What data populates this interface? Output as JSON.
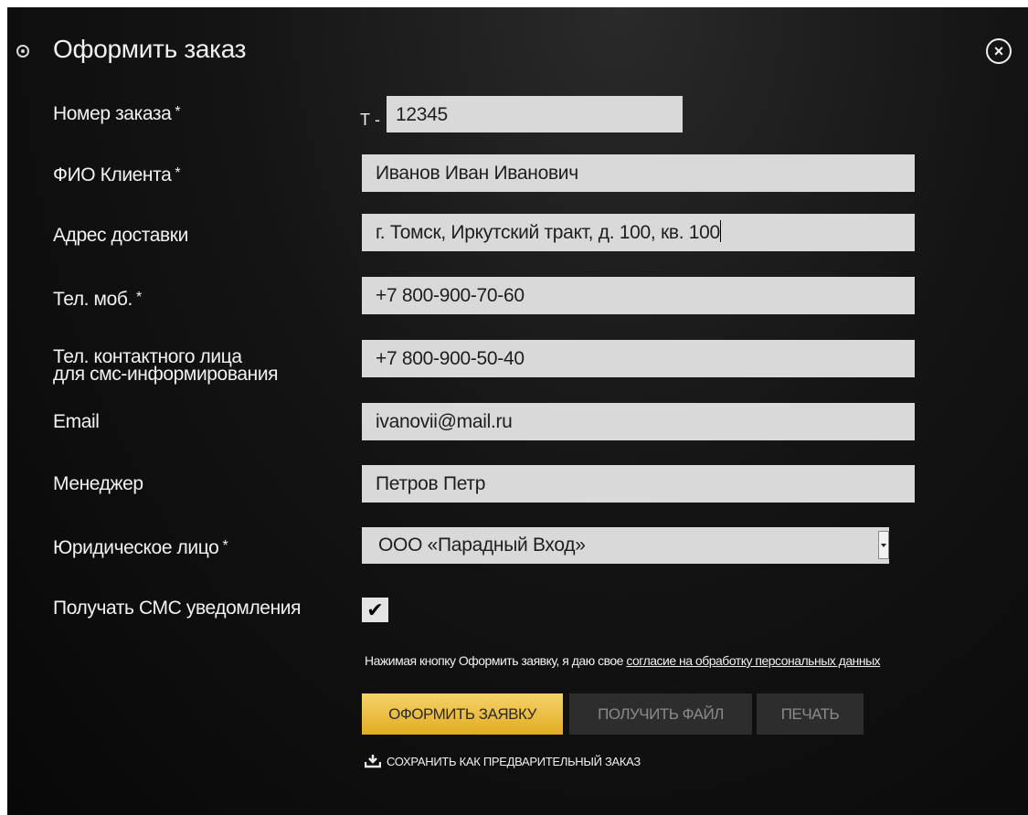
{
  "dialog": {
    "title": "Оформить заказ",
    "close_symbol": "×"
  },
  "fields": {
    "order_number": {
      "label": "Номер заказа",
      "prefix": "Т -",
      "value": "12345"
    },
    "client_name": {
      "label": "ФИО Клиента",
      "value": "Иванов Иван Иванович"
    },
    "address": {
      "label": "Адрес доставки",
      "value": "г. Томск, Иркутский тракт, д. 100, кв. 100"
    },
    "mobile": {
      "label": "Тел. моб.",
      "value": "+7 800-900-70-60"
    },
    "contact_phone": {
      "label_line1": "Тел. контактного лица",
      "label_line2": "для смс-информирования",
      "value": "+7 800-900-50-40"
    },
    "email": {
      "label": "Email",
      "value": "ivanovii@mail.ru"
    },
    "manager": {
      "label": "Менеджер",
      "value": "Петров Петр"
    },
    "legal_entity": {
      "label": "Юридическое лицо",
      "selected": "ООО «Парадный Вход»"
    },
    "sms": {
      "label": "Получать СМС уведомления",
      "checked": true,
      "check_symbol": "✔"
    }
  },
  "consent": {
    "text": "Нажимая кнопку Оформить заявку, я даю свое ",
    "link": "согласие на обработку персональных данных"
  },
  "buttons": {
    "submit": "ОФОРМИТЬ ЗАЯВКУ",
    "get_file": "ПОЛУЧИТЬ ФАЙЛ",
    "print": "ПЕЧАТЬ"
  },
  "save_draft": "СОХРАНИТЬ КАК ПРЕДВАРИТЕЛЬНЫЙ ЗАКАЗ",
  "icons": {
    "title": "radio-dot-icon",
    "close": "close-circle-icon",
    "dropdown": "chevron-down-icon",
    "save": "download-icon"
  },
  "colors": {
    "background": "#111111",
    "input_bg": "#d9d9d9",
    "primary_button": "#eabf45",
    "secondary_button": "#2d2d2d"
  }
}
